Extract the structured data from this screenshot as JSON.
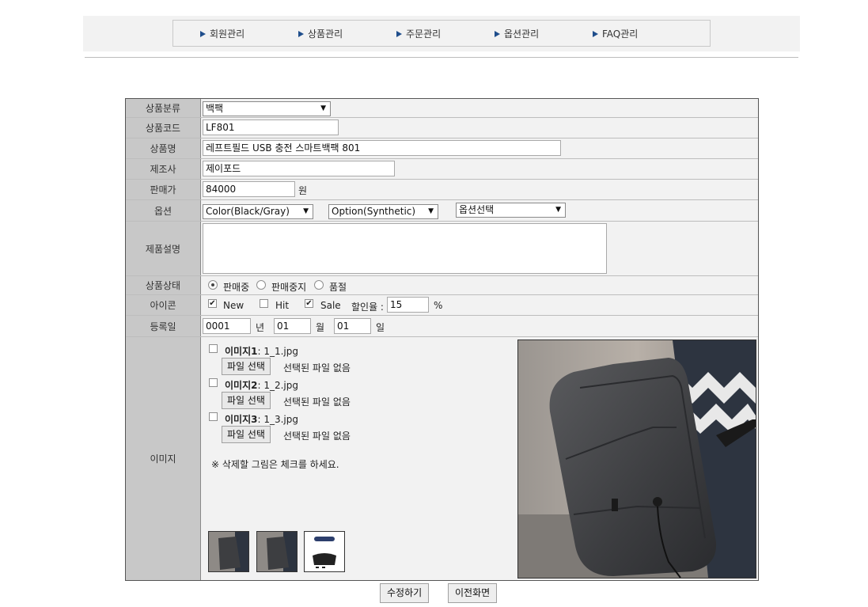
{
  "nav": {
    "items": [
      {
        "label": "회원관리"
      },
      {
        "label": "상품관리"
      },
      {
        "label": "주문관리"
      },
      {
        "label": "옵션관리"
      },
      {
        "label": "FAQ관리"
      }
    ]
  },
  "form": {
    "category": {
      "label": "상품분류",
      "value": "백팩"
    },
    "code": {
      "label": "상품코드",
      "value": "LF801"
    },
    "name": {
      "label": "상품명",
      "value": "레프트필드 USB 충전 스마트백팩 801"
    },
    "maker": {
      "label": "제조사",
      "value": "제이포드"
    },
    "price": {
      "label": "판매가",
      "value": "84000",
      "unit": "원"
    },
    "options": {
      "label": "옵션",
      "opt1": "Color(Black/Gray)",
      "opt2": "Option(Synthetic)",
      "opt3": "옵션선택"
    },
    "description": {
      "label": "제품설명",
      "value": ""
    },
    "status": {
      "label": "상품상태",
      "choices": [
        "판매중",
        "판매중지",
        "품절"
      ],
      "selected": "판매중"
    },
    "icons": {
      "label": "아이콘",
      "new": "New",
      "hit": "Hit",
      "sale": "Sale",
      "discount_label": "할인율 :",
      "discount_value": "15",
      "percent": "%"
    },
    "regdate": {
      "label": "등록일",
      "year": "0001",
      "year_unit": "년",
      "month": "01",
      "month_unit": "월",
      "day": "01",
      "day_unit": "일"
    },
    "images": {
      "label": "이미지",
      "items": [
        {
          "title": "이미지1",
          "file": ": 1_1.jpg"
        },
        {
          "title": "이미지2",
          "file": ": 1_2.jpg"
        },
        {
          "title": "이미지3",
          "file": ": 1_3.jpg"
        }
      ],
      "file_button": "파일 선택",
      "no_file": "선택된 파일 없음",
      "notice": "※ 삭제할 그림은 체크를 하세요."
    }
  },
  "buttons": {
    "submit": "수정하기",
    "back": "이전화면"
  },
  "colors": {
    "nav_arrow": "#1f4e8c",
    "label_bg": "#c8c8c8",
    "form_bg": "#f2f2f2"
  }
}
